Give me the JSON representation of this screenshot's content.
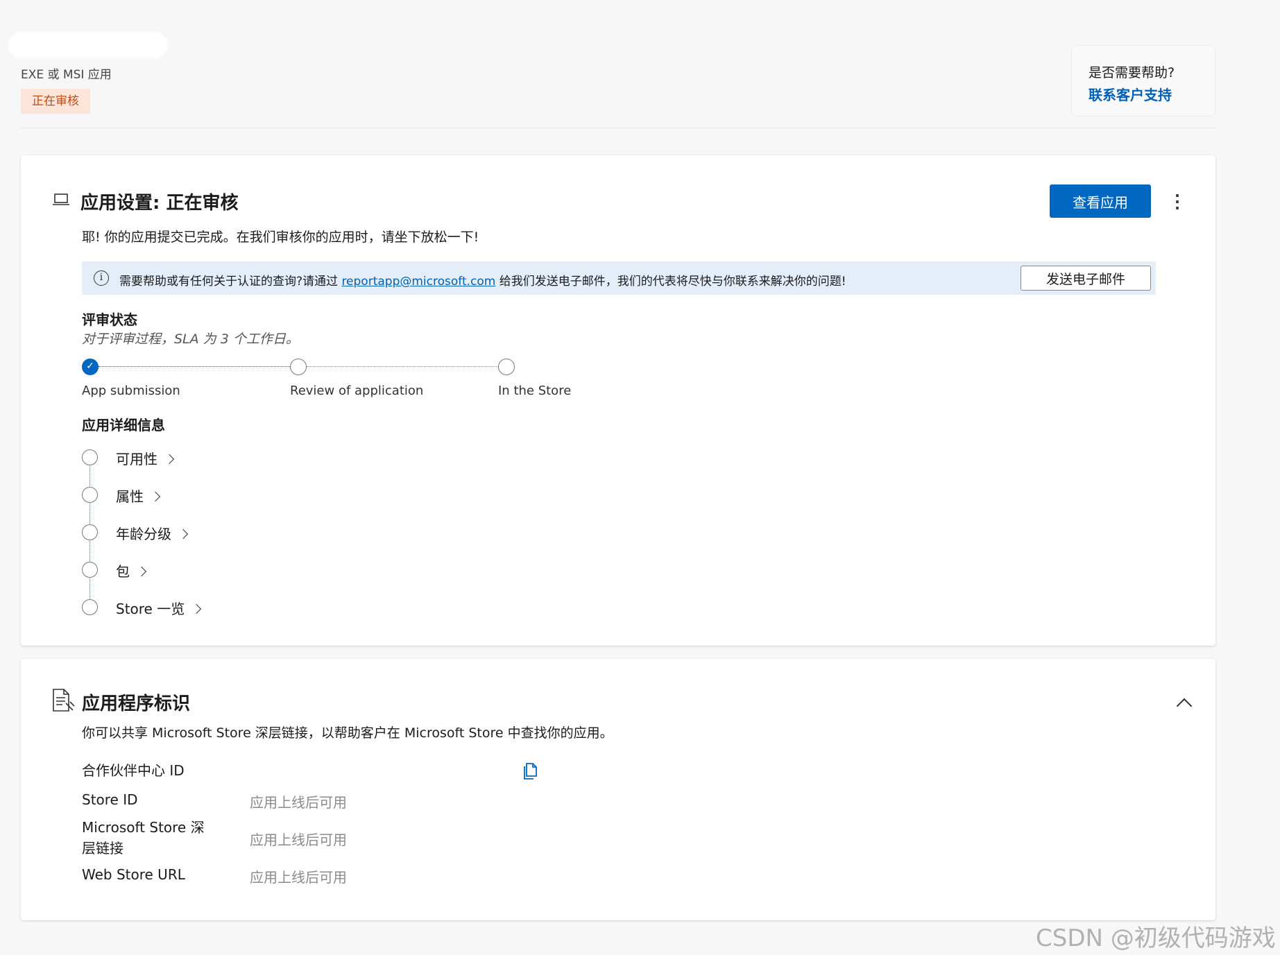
{
  "header": {
    "app_type": "EXE 或 MSI 应用",
    "status_pill": "正在审核",
    "help_question": "是否需要帮助?",
    "help_link": "联系客户支持"
  },
  "app_settings": {
    "title": "应用设置: 正在审核",
    "description": "耶! 你的应用提交已完成。在我们审核你的应用时，请坐下放松一下!",
    "view_button": "查看应用",
    "more_button": "⋮",
    "info_bar": {
      "text_before": "需要帮助或有任何关于认证的查询?请通过 ",
      "email": "reportapp@microsoft.com",
      "text_after": " 给我们发送电子邮件，我们的代表将尽快与你联系来解决你的问题!",
      "button": "发送电子邮件"
    },
    "review_status": {
      "heading": "评审状态",
      "sla": "对于评审过程，SLA 为 3 个工作日。",
      "steps": [
        {
          "label": "App submission",
          "completed": true
        },
        {
          "label": "Review of application",
          "completed": false
        },
        {
          "label": "In the Store",
          "completed": false
        }
      ]
    },
    "details": {
      "heading": "应用详细信息",
      "items": [
        "可用性",
        "属性",
        "年龄分级",
        "包",
        "Store 一览"
      ]
    }
  },
  "app_identity": {
    "title": "应用程序标识",
    "description": "你可以共享 Microsoft Store 深层链接，以帮助客户在 Microsoft Store 中查找你的应用。",
    "rows": [
      {
        "label": "合作伙伴中心 ID",
        "value": ""
      },
      {
        "label": "Store ID",
        "value": "应用上线后可用"
      },
      {
        "label_line1": "Microsoft Store 深",
        "label_line2": "层链接",
        "value": "应用上线后可用"
      },
      {
        "label": "Web Store URL",
        "value": "应用上线后可用"
      }
    ]
  },
  "watermark": "CSDN @初级代码游戏",
  "colors": {
    "accent": "#0067c0",
    "pill_bg": "#fde4d8",
    "pill_text": "#c24b14",
    "info_bg": "#e4eef8"
  }
}
